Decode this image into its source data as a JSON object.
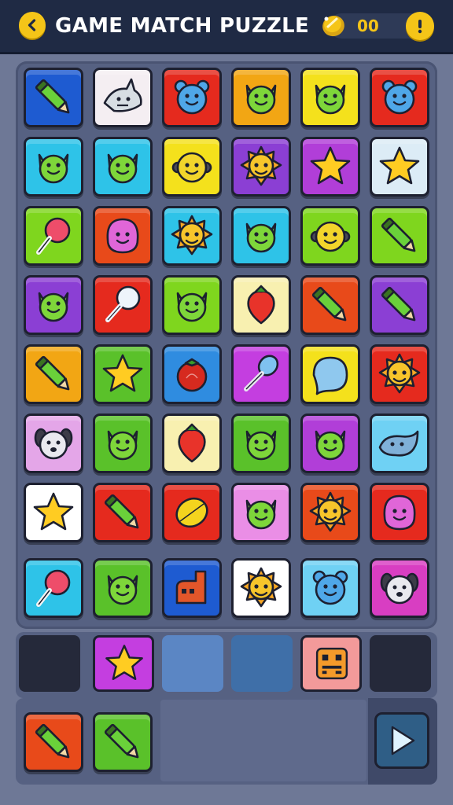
{
  "header": {
    "title": "GAME MATCH PUZZLE",
    "coins": "00",
    "back_icon": "chevron-left-icon",
    "info_icon": "exclamation-icon",
    "coin_icon": "coin-icon"
  },
  "colors": {
    "accent": "#f5c518",
    "header_bg": "#1f2a44",
    "board_bg": "#566182"
  },
  "board": {
    "rows": [
      [
        {
          "icon": "crayon",
          "bg": "#1e5bd1"
        },
        {
          "icon": "shark",
          "bg": "#f4eef2"
        },
        {
          "icon": "bear-face",
          "bg": "#e52a1e"
        },
        {
          "icon": "cat-face",
          "bg": "#f2a614"
        },
        {
          "icon": "cat-face",
          "bg": "#f4e11c"
        },
        {
          "icon": "bear-face",
          "bg": "#e52a1e"
        }
      ],
      [
        {
          "icon": "cat-face",
          "bg": "#2ec3e8"
        },
        {
          "icon": "cat-face",
          "bg": "#2ec3e8"
        },
        {
          "icon": "monkey-face",
          "bg": "#f4e11c"
        },
        {
          "icon": "sun-face",
          "bg": "#8b3fd4"
        },
        {
          "icon": "star",
          "bg": "#b13ed8"
        },
        {
          "icon": "star",
          "bg": "#dcecf6"
        }
      ],
      [
        {
          "icon": "lollipop",
          "bg": "#7fd61e"
        },
        {
          "icon": "blob-face",
          "bg": "#e84a1a"
        },
        {
          "icon": "sun-face",
          "bg": "#2ec3e8"
        },
        {
          "icon": "cat-face",
          "bg": "#2ec3e8"
        },
        {
          "icon": "monkey-face",
          "bg": "#7fd61e"
        },
        {
          "icon": "crayon",
          "bg": "#7fd61e"
        }
      ],
      [
        {
          "icon": "cat-face",
          "bg": "#8b3fd4"
        },
        {
          "icon": "paddle",
          "bg": "#e52a1e"
        },
        {
          "icon": "cat-face",
          "bg": "#7fd61e"
        },
        {
          "icon": "strawberry",
          "bg": "#f8f0b0"
        },
        {
          "icon": "crayon",
          "bg": "#e84a1a"
        },
        {
          "icon": "crayon",
          "bg": "#8b3fd4"
        }
      ],
      [
        {
          "icon": "crayon",
          "bg": "#f2a614"
        },
        {
          "icon": "star",
          "bg": "#5ac12a"
        },
        {
          "icon": "tomato",
          "bg": "#2f8ce0"
        },
        {
          "icon": "spoon",
          "bg": "#c43ee0"
        },
        {
          "icon": "blob",
          "bg": "#f4e11c"
        },
        {
          "icon": "sun-face",
          "bg": "#e52a1e"
        }
      ],
      [
        {
          "icon": "dog-face",
          "bg": "#e4a6e8"
        },
        {
          "icon": "cat-face",
          "bg": "#5ac12a"
        },
        {
          "icon": "strawberry",
          "bg": "#f8f0b0"
        },
        {
          "icon": "cat-face",
          "bg": "#5ac12a"
        },
        {
          "icon": "cat-face",
          "bg": "#b13ed8"
        },
        {
          "icon": "whale",
          "bg": "#6fd1f4"
        }
      ],
      [
        {
          "icon": "star",
          "bg": "#ffffff"
        },
        {
          "icon": "crayon",
          "bg": "#e52a1e"
        },
        {
          "icon": "lemon",
          "bg": "#e52a1e"
        },
        {
          "icon": "cat-face",
          "bg": "#ea8ee6"
        },
        {
          "icon": "sun-face",
          "bg": "#e84a1a"
        },
        {
          "icon": "blob-face",
          "bg": "#e52a1e"
        }
      ],
      [
        {
          "icon": "lollipop",
          "bg": "#2ec3e8"
        },
        {
          "icon": "cat-face",
          "bg": "#5ac12a"
        },
        {
          "icon": "boot",
          "bg": "#1e5bd1"
        },
        {
          "icon": "sun-face",
          "bg": "#ffffff"
        },
        {
          "icon": "bear-face",
          "bg": "#6fd1f4"
        },
        {
          "icon": "dog-face",
          "bg": "#d83ec2"
        }
      ]
    ]
  },
  "tray": {
    "slots": [
      {
        "state": "empty",
        "bg": "#25293a"
      },
      {
        "icon": "star",
        "bg": "#c43ee0"
      },
      {
        "state": "empty",
        "bg": "#5b86c4"
      },
      {
        "state": "empty",
        "bg": "#3f6fa8"
      },
      {
        "icon": "robot",
        "bg": "#f39a9a"
      },
      {
        "state": "empty",
        "bg": "#25293a"
      }
    ]
  },
  "bottom": {
    "pieces": [
      {
        "icon": "crayon",
        "bg": "#e84a1a"
      },
      {
        "icon": "crayon",
        "bg": "#5ac12a"
      }
    ],
    "play_icon": "play-icon"
  }
}
